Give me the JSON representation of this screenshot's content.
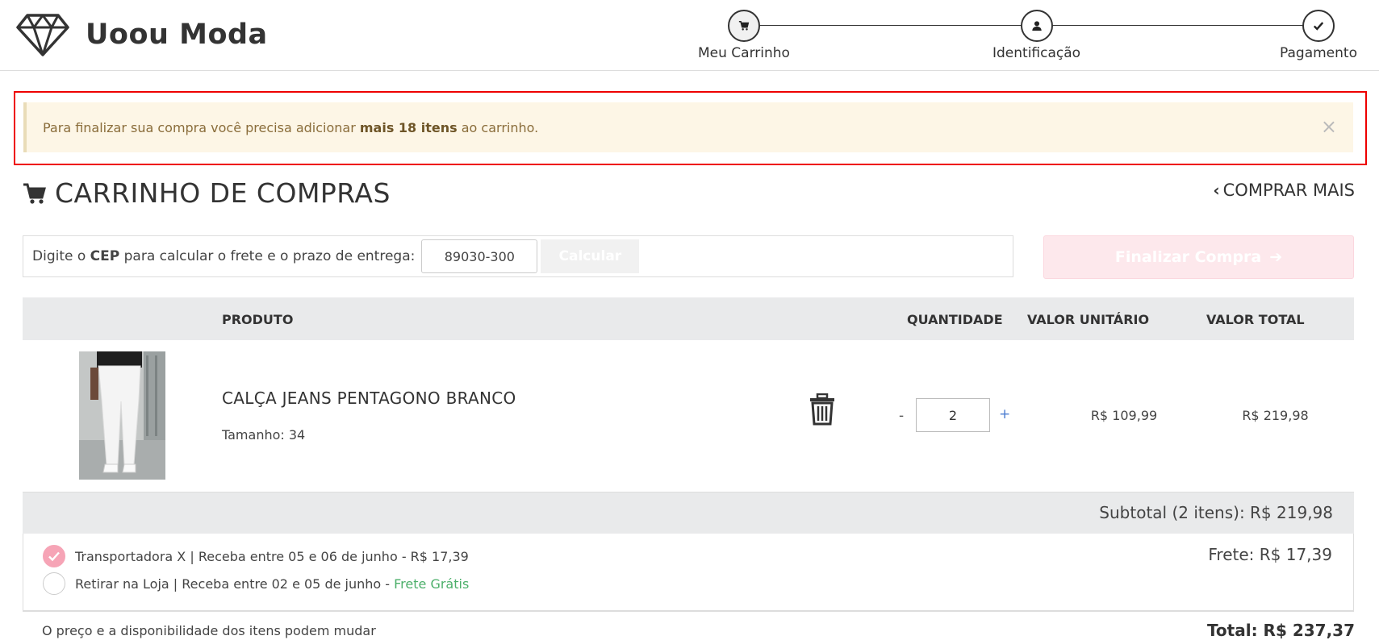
{
  "brand": {
    "name": "Uoou Moda",
    "logo_icon": "diamond-icon"
  },
  "steps": [
    {
      "label": "Meu Carrinho",
      "icon": "cart-icon",
      "active": true
    },
    {
      "label": "Identificação",
      "icon": "user-icon",
      "active": false
    },
    {
      "label": "Pagamento",
      "icon": "check-icon",
      "active": false
    }
  ],
  "alert": {
    "text_before": "Para finalizar sua compra você precisa adicionar ",
    "text_bold": "mais 18 itens",
    "text_after": " ao carrinho.",
    "close": "×"
  },
  "cart": {
    "title": "CARRINHO DE COMPRAS",
    "buy_more": "COMPRAR MAIS"
  },
  "cep": {
    "label_before": "Digite o ",
    "label_bold": "CEP",
    "label_after": " para calcular o frete e o prazo de entrega:",
    "value": "89030-300",
    "button": "Calcular"
  },
  "finalize": {
    "label": "Finalizar Compra"
  },
  "table": {
    "headers": {
      "product": "PRODUTO",
      "quantity": "QUANTIDADE",
      "unit_price": "VALOR UNITÁRIO",
      "total_price": "VALOR TOTAL"
    }
  },
  "item": {
    "name": "CALÇA JEANS PENTAGONO BRANCO",
    "size": "Tamanho: 34",
    "quantity": "2",
    "minus": "-",
    "plus": "+",
    "unit_price": "R$ 109,99",
    "total_price": "R$ 219,98"
  },
  "subtotal": "Subtotal (2 itens): R$ 219,98",
  "shipping": {
    "options": [
      {
        "text": "Transportadora X | Receba entre 05 e 06 de junho - R$ 17,39",
        "extra": "",
        "checked": true
      },
      {
        "text": "Retirar na Loja | Receba entre 02 e 05 de junho - ",
        "extra": "Frete Grátis",
        "checked": false
      }
    ],
    "frete": "Frete: R$ 17,39"
  },
  "footer": {
    "note": "O preço e a disponibilidade dos itens podem mudar",
    "total": "Total: R$ 237,37"
  },
  "colors": {
    "alert_bg": "#fdf6e6",
    "accent_pink": "#f6a4b6",
    "free_green": "#4caf6a",
    "highlight_red": "#ee0000"
  }
}
